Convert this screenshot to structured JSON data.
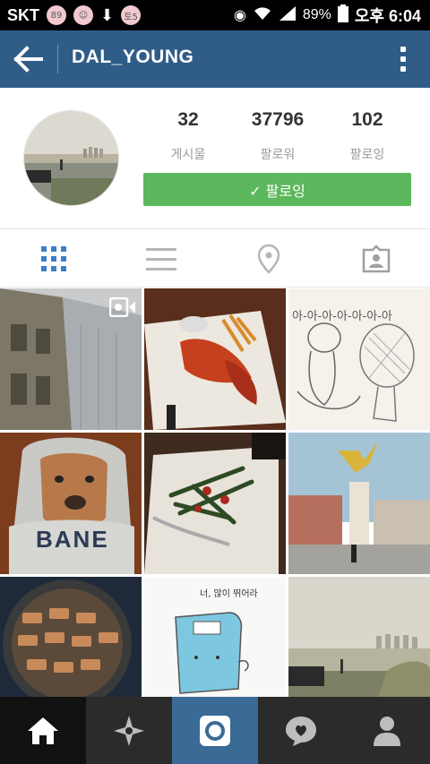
{
  "status_bar": {
    "carrier": "SKT",
    "badge1": "89",
    "badge2": "토5",
    "battery": "89%",
    "time": "오후 6:04"
  },
  "header": {
    "title": "DAL_YOUNG",
    "back_icon": "arrow-left-icon",
    "menu_icon": "overflow-menu-icon"
  },
  "profile": {
    "posts_count": "32",
    "posts_label": "게시물",
    "followers_count": "37796",
    "followers_label": "팔로워",
    "following_count": "102",
    "following_label": "팔로잉",
    "follow_button": "✓ 팔로잉",
    "follow_color": "#5cb85c"
  },
  "tabs": [
    {
      "name": "grid-view",
      "icon": "grid-icon",
      "active": true
    },
    {
      "name": "list-view",
      "icon": "list-icon",
      "active": false
    },
    {
      "name": "map-view",
      "icon": "location-pin-icon",
      "active": false
    },
    {
      "name": "tagged-view",
      "icon": "tagged-person-icon",
      "active": false
    }
  ],
  "photos": {
    "comic_text": "아-아-아-아-아-아-아",
    "comic2_text": "너, 많이 뛰어라",
    "hoodie_text": "BANE"
  },
  "bottom_nav": [
    {
      "name": "home",
      "icon": "home-icon"
    },
    {
      "name": "explore",
      "icon": "explore-compass-icon"
    },
    {
      "name": "camera",
      "icon": "camera-icon"
    },
    {
      "name": "activity",
      "icon": "heart-bubble-icon"
    },
    {
      "name": "profile",
      "icon": "person-icon"
    }
  ],
  "colors": {
    "brand": "#2f5d88",
    "accent_tab": "#3b7ec9",
    "nav_bg": "#2b2b2b"
  }
}
